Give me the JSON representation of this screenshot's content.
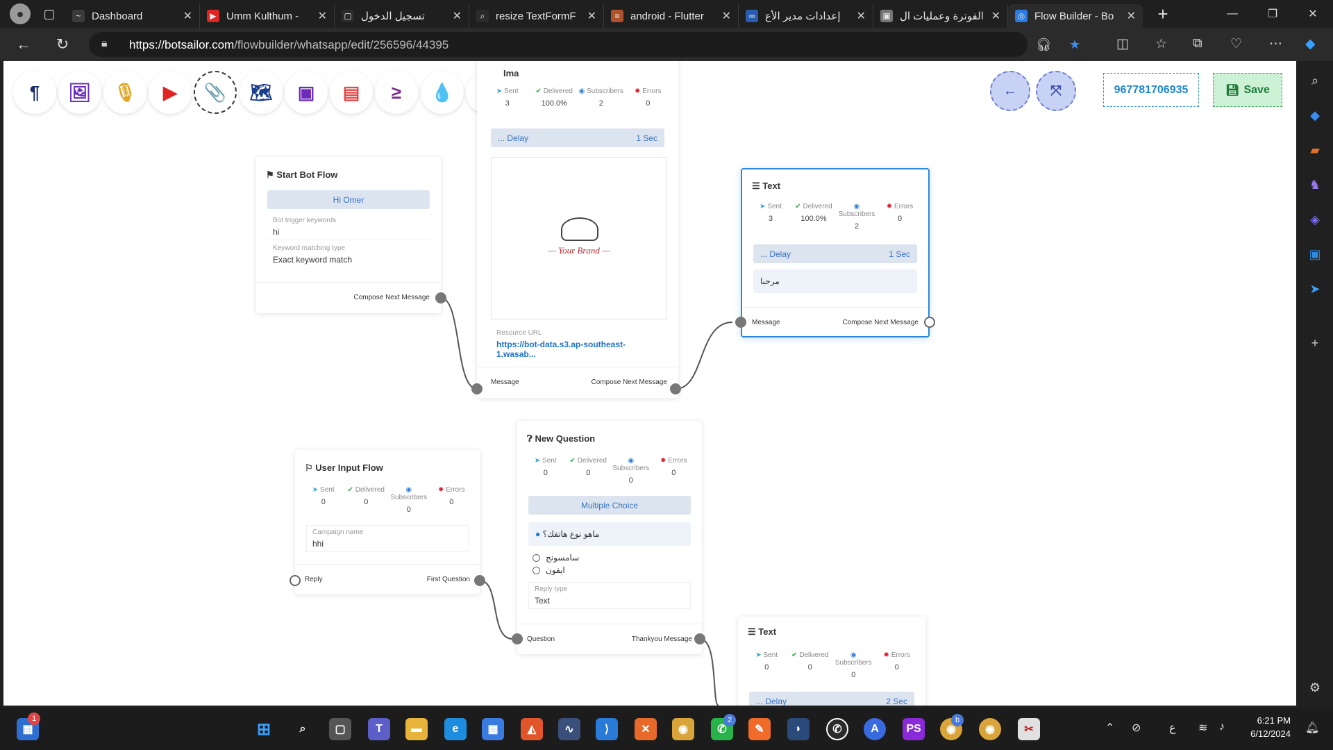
{
  "browser": {
    "tabs": [
      {
        "title": "Dashboard",
        "fav_color": "#3b3b3b",
        "fav_glyph": "~"
      },
      {
        "title": "Umm Kulthum -",
        "fav_color": "#e02424",
        "fav_glyph": "▶"
      },
      {
        "title": "تسجيل الدخول",
        "fav_color": "#2b2b2b",
        "fav_glyph": "▢"
      },
      {
        "title": "resize TextFormF",
        "fav_color": "#2b2b2b",
        "fav_glyph": "⌕"
      },
      {
        "title": "android - Flutter",
        "fav_color": "#b0532c",
        "fav_glyph": "≡"
      },
      {
        "title": "إعدادات مدير الأع",
        "fav_color": "#2a5db0",
        "fav_glyph": "∞"
      },
      {
        "title": "الفوترة وعمليات ال",
        "fav_color": "#777777",
        "fav_glyph": "▣"
      },
      {
        "title": "Flow Builder - Bo",
        "fav_color": "#2c7be5",
        "fav_glyph": "◎"
      }
    ],
    "url_host": "https://botsailor.com",
    "url_path": "/flowbuilder/whatsapp/edit/256596/44395"
  },
  "toolbar": {
    "tools": [
      {
        "name": "text-tool-icon",
        "glyph": "¶",
        "color": "#1b2e6b"
      },
      {
        "name": "image-tool-icon",
        "glyph": "🖼",
        "color": "#6a2ec7"
      },
      {
        "name": "audio-tool-icon",
        "glyph": "🎙",
        "color": "#e5a51c"
      },
      {
        "name": "video-tool-icon",
        "glyph": "▶",
        "color": "#e02424"
      },
      {
        "name": "file-tool-icon",
        "glyph": "📎",
        "color": "#1e9e3e"
      },
      {
        "name": "location-tool-icon",
        "glyph": "🗺",
        "color": "#1b3e8c"
      },
      {
        "name": "interactive-tool-icon",
        "glyph": "▣",
        "color": "#6d2bb8"
      },
      {
        "name": "catalog-tool-icon",
        "glyph": "▤",
        "color": "#e04a4a"
      },
      {
        "name": "sequence-tool-icon",
        "glyph": "≥",
        "color": "#7a2d8c"
      },
      {
        "name": "drop-tool-icon",
        "glyph": "💧",
        "color": "#d8121e"
      },
      {
        "name": "stack-tool-icon",
        "glyph": "≋",
        "color": "#1e9e3e"
      },
      {
        "name": "palette-tool-icon",
        "glyph": "🎨",
        "color": "#27b33b"
      }
    ],
    "phone": "967781706935",
    "save_label": "Save"
  },
  "nodes": {
    "start": {
      "title": "Start Bot Flow",
      "reply": "Hi Omer",
      "trigger_label": "Bot trigger keywords",
      "trigger_value": "hi",
      "match_label": "Keyword matching type",
      "match_value": "Exact keyword match",
      "out_label": "Compose Next Message"
    },
    "image": {
      "title": "Ima",
      "sent": "3",
      "delivered": "100.0%",
      "subscribers": "2",
      "errors": "0",
      "delay_label": "... Delay",
      "delay_value": "1 Sec",
      "brand_text": "Your Brand",
      "resource_label": "Resource URL",
      "resource_value": "https://bot-data.s3.ap-southeast-1.wasab...",
      "in_label": "Message",
      "out_label": "Compose Next Message"
    },
    "text1": {
      "title": "Text",
      "sent": "3",
      "delivered": "100.0%",
      "subscribers": "2",
      "errors": "0",
      "delay_label": "... Delay",
      "delay_value": "1 Sec",
      "message": "مرحبا",
      "in_label": "Message",
      "out_label": "Compose Next Message"
    },
    "user_input": {
      "title": "User Input Flow",
      "sent": "0",
      "delivered": "0",
      "subscribers": "0",
      "errors": "0",
      "campaign_label": "Campaign name",
      "campaign_value": "hhi",
      "in_label": "Reply",
      "out_label": "First Question"
    },
    "question": {
      "title": "New Question",
      "sent": "0",
      "delivered": "0",
      "subscribers": "0",
      "errors": "0",
      "type_bar": "Multiple Choice",
      "question_text": "ماهو نوع هاتفك؟",
      "options": [
        "سامسونج",
        "ايفون"
      ],
      "reply_type_label": "Reply type",
      "reply_type_value": "Text",
      "in_label": "Question",
      "out_label": "Thankyou Message"
    },
    "text2": {
      "title": "Text",
      "sent": "0",
      "delivered": "0",
      "subscribers": "0",
      "errors": "0",
      "delay_label": "... Delay",
      "delay_value": "2 Sec"
    },
    "stat_labels": {
      "sent": "Sent",
      "delivered": "Delivered",
      "subscribers": "Subscribers",
      "errors": "Errors"
    }
  },
  "taskbar": {
    "notification_badge": "1",
    "whatsapp_badge": "2",
    "chrome_badge": "b",
    "lang": "ع",
    "time": "6:21 PM",
    "date": "6/12/2024"
  }
}
